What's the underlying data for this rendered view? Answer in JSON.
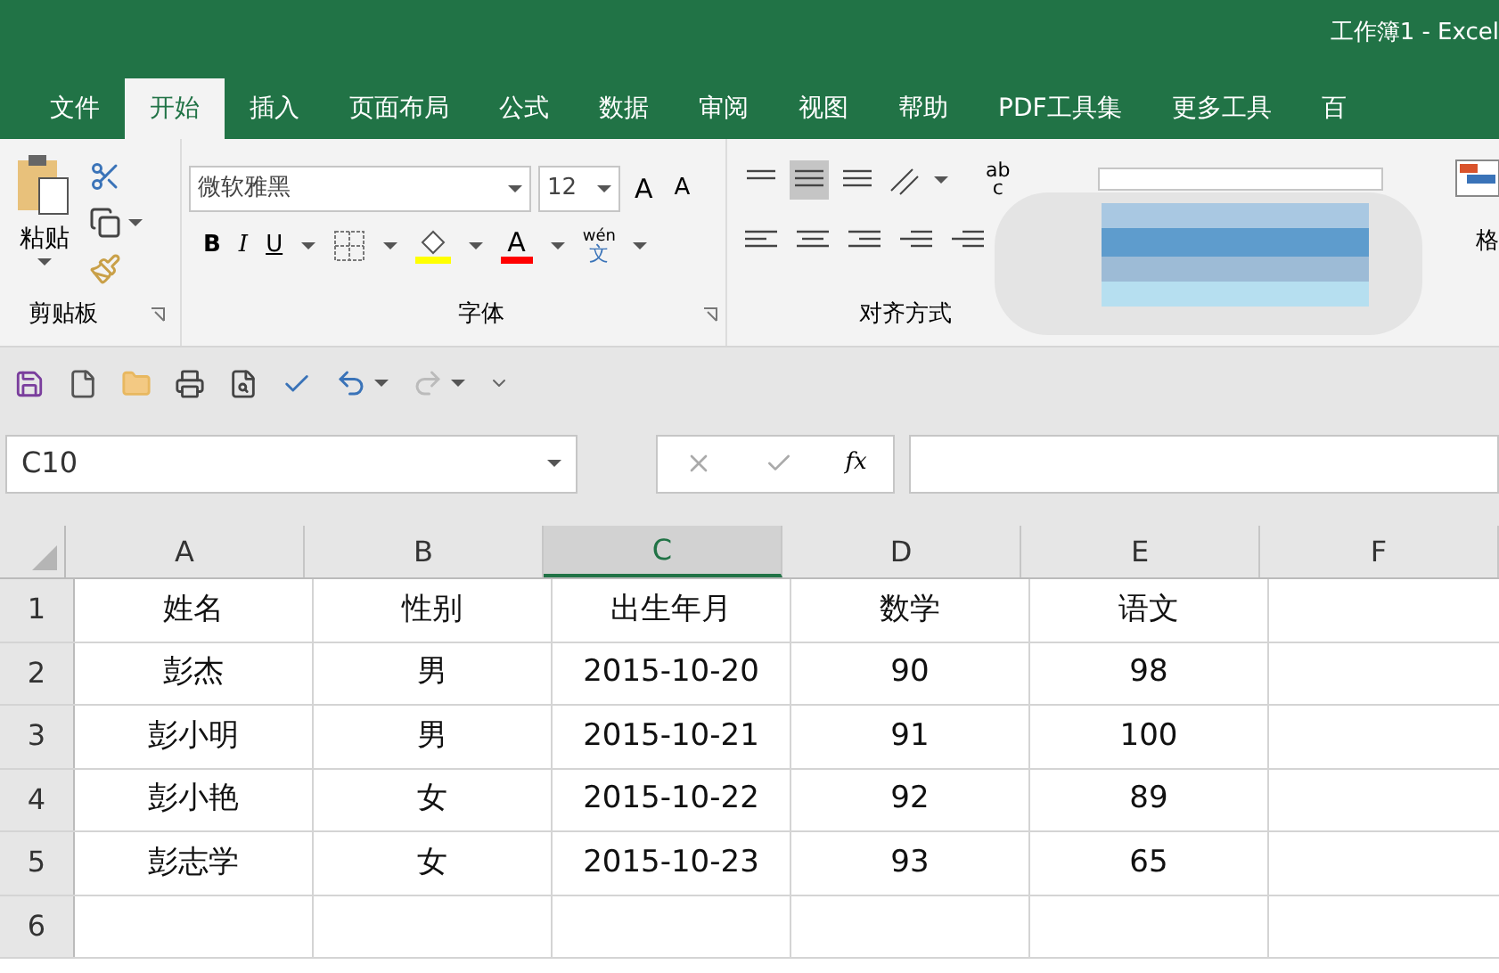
{
  "window": {
    "title": "工作簿1  -  Excel"
  },
  "tabs": [
    {
      "label": "文件",
      "selected": false
    },
    {
      "label": "开始",
      "selected": true
    },
    {
      "label": "插入",
      "selected": false
    },
    {
      "label": "页面布局",
      "selected": false
    },
    {
      "label": "公式",
      "selected": false
    },
    {
      "label": "数据",
      "selected": false
    },
    {
      "label": "审阅",
      "selected": false
    },
    {
      "label": "视图",
      "selected": false
    },
    {
      "label": "帮助",
      "selected": false
    },
    {
      "label": "PDF工具集",
      "selected": false
    },
    {
      "label": "更多工具",
      "selected": false
    },
    {
      "label": "百",
      "selected": false
    }
  ],
  "ribbon": {
    "clipboard": {
      "paste_label": "粘贴",
      "group_label": "剪贴板"
    },
    "font": {
      "font_name": "微软雅黑",
      "font_size": "12",
      "grow": "A",
      "shrink": "A",
      "bold": "B",
      "italic": "I",
      "underline": "U",
      "font_color": "A",
      "phonetic_top": "wén",
      "phonetic_bottom": "文",
      "group_label": "字体"
    },
    "alignment": {
      "wrap_top": "ab",
      "wrap_bottom": "c",
      "group_label": "对齐方式"
    },
    "styles": {
      "label": "格"
    }
  },
  "name_box": "C10",
  "formula_bar": {
    "fx": "fx"
  },
  "grid": {
    "columns": [
      {
        "label": "A",
        "selected": false
      },
      {
        "label": "B",
        "selected": false
      },
      {
        "label": "C",
        "selected": true
      },
      {
        "label": "D",
        "selected": false
      },
      {
        "label": "E",
        "selected": false
      },
      {
        "label": "F",
        "selected": false
      }
    ],
    "rows": [
      {
        "header": "1",
        "cells": [
          "姓名",
          "性别",
          "出生年月",
          "数学",
          "语文"
        ]
      },
      {
        "header": "2",
        "cells": [
          "彭杰",
          "男",
          "2015-10-20",
          "90",
          "98"
        ]
      },
      {
        "header": "3",
        "cells": [
          "彭小明",
          "男",
          "2015-10-21",
          "91",
          "100"
        ]
      },
      {
        "header": "4",
        "cells": [
          "彭小艳",
          "女",
          "2015-10-22",
          "92",
          "89"
        ]
      },
      {
        "header": "5",
        "cells": [
          "彭志学",
          "女",
          "2015-10-23",
          "93",
          "65"
        ]
      },
      {
        "header": "6",
        "cells": []
      }
    ]
  }
}
